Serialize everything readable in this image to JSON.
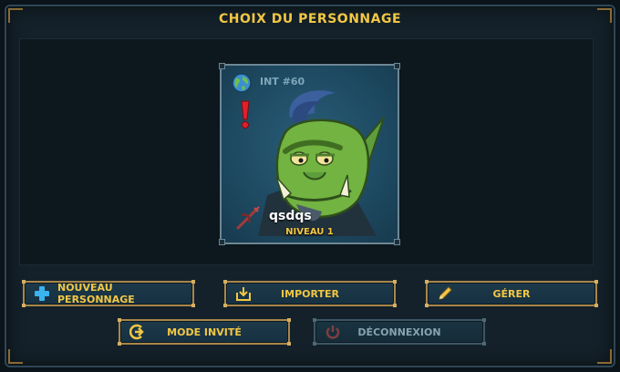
{
  "title": "CHOIX DU PERSONNAGE",
  "character": {
    "server_icon": "globe-icon",
    "server_id": "INT #60",
    "alert_icon": "exclamation-icon",
    "name": "qsdqs",
    "level": "NIVEAU 1",
    "class_icon": "crossbow-icon"
  },
  "buttons": {
    "new_character": {
      "label": "NOUVEAU PERSONNAGE",
      "icon": "plus-icon"
    },
    "import": {
      "label": "IMPORTER",
      "icon": "import-icon"
    },
    "manage": {
      "label": "GÉRER",
      "icon": "pencil-icon"
    },
    "guest_mode": {
      "label": "MODE INVITÉ",
      "icon": "enter-icon"
    },
    "logout": {
      "label": "DÉCONNEXION",
      "icon": "power-icon",
      "disabled": true
    }
  },
  "colors": {
    "accent_gold": "#f2c744",
    "button_bg": "#1d3a4a",
    "card_bg": "#1e4b63",
    "disabled_text": "#88a3b0"
  }
}
